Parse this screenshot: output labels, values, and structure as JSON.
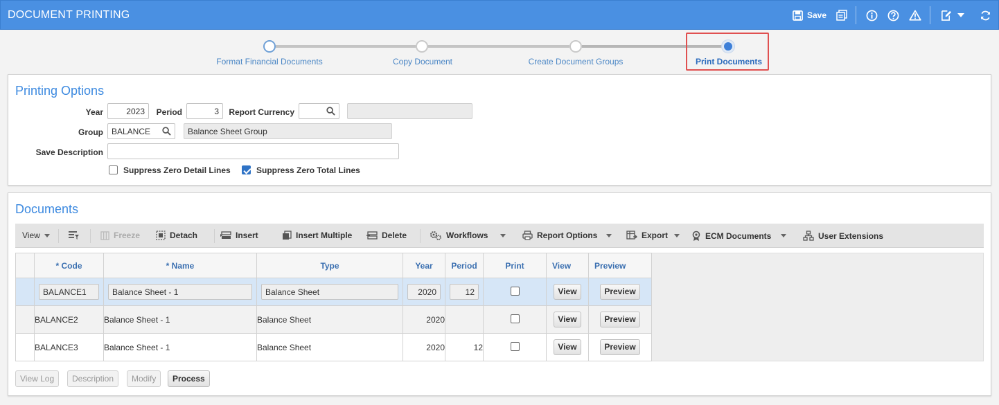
{
  "window": {
    "title": "DOCUMENT PRINTING",
    "save_label": "Save",
    "accent": "#4a90e2"
  },
  "steps": [
    {
      "label": "Format Financial Documents"
    },
    {
      "label": "Copy Document"
    },
    {
      "label": "Create Document Groups"
    },
    {
      "label": "Print Documents"
    }
  ],
  "printing_options": {
    "title": "Printing Options",
    "year_label": "Year",
    "year_value": "2023",
    "period_label": "Period",
    "period_value": "3",
    "report_currency_label": "Report Currency",
    "report_currency_value": "",
    "report_currency_desc": "",
    "group_label": "Group",
    "group_value": "BALANCE",
    "group_desc": "Balance Sheet Group",
    "save_description_label": "Save Description",
    "save_description_value": "",
    "suppress_zero_detail_label": "Suppress Zero Detail Lines",
    "suppress_zero_total_label": "Suppress Zero Total Lines"
  },
  "documents": {
    "title": "Documents",
    "toolbar": {
      "view": "View",
      "freeze": "Freeze",
      "detach": "Detach",
      "insert": "Insert",
      "insert_multiple": "Insert Multiple",
      "delete": "Delete",
      "workflows": "Workflows",
      "report_options": "Report Options",
      "export": "Export",
      "ecm_documents": "ECM Documents",
      "user_extensions": "User Extensions"
    },
    "columns": {
      "code": "* Code",
      "name": "* Name",
      "type": "Type",
      "year": "Year",
      "period": "Period",
      "print": "Print",
      "view": "View",
      "preview": "Preview"
    },
    "rows": [
      {
        "code": "BALANCE1",
        "name": "Balance Sheet - 1",
        "type": "Balance Sheet",
        "year": "2020",
        "period": "12",
        "view_btn": "View",
        "preview_btn": "Preview"
      },
      {
        "code": "BALANCE2",
        "name": "Balance Sheet - 1",
        "type": "Balance Sheet",
        "year": "2020",
        "period": "",
        "view_btn": "View",
        "preview_btn": "Preview"
      },
      {
        "code": "BALANCE3",
        "name": "Balance Sheet - 1",
        "type": "Balance Sheet",
        "year": "2020",
        "period": "12",
        "view_btn": "View",
        "preview_btn": "Preview"
      }
    ]
  },
  "footer": {
    "view_log": "View Log",
    "description": "Description",
    "modify": "Modify",
    "process": "Process"
  }
}
